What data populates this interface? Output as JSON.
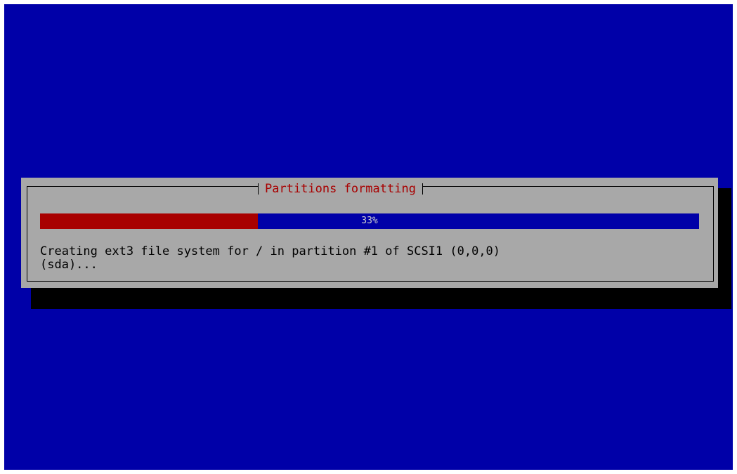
{
  "dialog": {
    "title": "Partitions formatting",
    "progress": {
      "percent": 33,
      "label": "33%"
    },
    "message": {
      "line1": "Creating ext3 file system for / in partition #1 of SCSI1 (0,0,0)",
      "line2": "(sda)..."
    }
  },
  "colors": {
    "background": "#0000a8",
    "dialog": "#a8a8a8",
    "title": "#a80000",
    "progress_fill": "#a80000",
    "progress_track": "#0000a8",
    "shadow": "#000000"
  }
}
